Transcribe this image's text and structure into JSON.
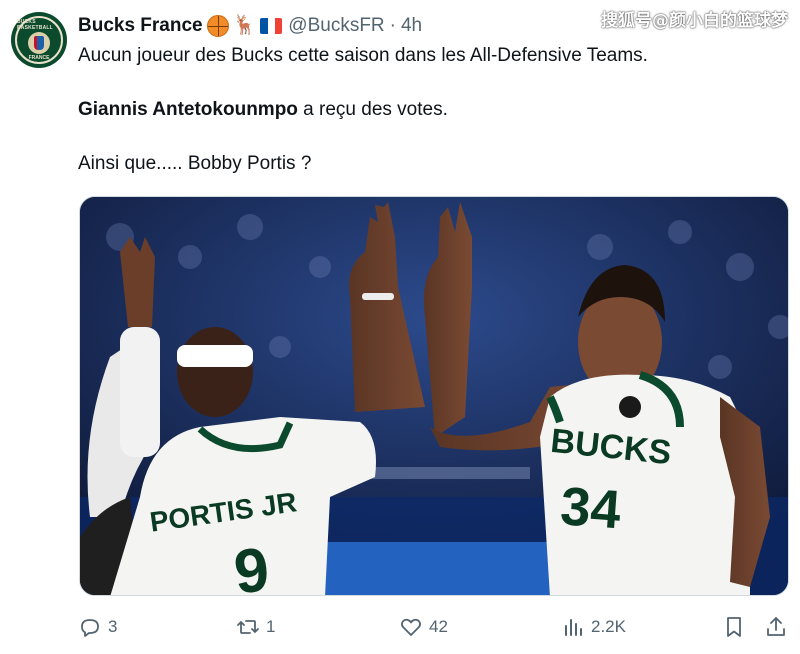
{
  "tweet": {
    "author": {
      "name": "Bucks France",
      "handle": "@BucksFR",
      "separator": "·",
      "time": "4h",
      "avatar_icon": "bucks-basketball-france-logo-icon",
      "avatar_top_text": "BUCKS BASKETBALL",
      "avatar_bottom_text": "FRANCE",
      "emojis": [
        "basketball-icon",
        "deer-icon",
        "france-flag-icon"
      ]
    },
    "text": {
      "line1": "Aucun joueur des Bucks cette saison dans les All-Defensive Teams.",
      "line2_bold": "Giannis Antetokounmpo",
      "line2_rest": " a reçu des votes.",
      "line3": "Ainsi que..... Bobby Portis ?"
    },
    "media": {
      "left_player_name": "PORTIS JR",
      "left_player_number": "9",
      "right_player_team": "BUCKS",
      "right_player_number": "34"
    },
    "actions": {
      "reply": {
        "icon": "reply-icon",
        "count": "3"
      },
      "retweet": {
        "icon": "retweet-icon",
        "count": "1"
      },
      "like": {
        "icon": "heart-icon",
        "count": "42"
      },
      "views": {
        "icon": "views-chart-icon",
        "count": "2.2K"
      },
      "bookmark": {
        "icon": "bookmark-icon"
      },
      "share": {
        "icon": "share-icon"
      }
    }
  },
  "watermark": "搜狐号@颜小白的篮球梦",
  "colors": {
    "text_primary": "#0f1419",
    "text_secondary": "#536471",
    "bucks_green": "#0b4a2d",
    "bucks_cream": "#eee1c6",
    "arena_blue": "#1b2a55"
  }
}
